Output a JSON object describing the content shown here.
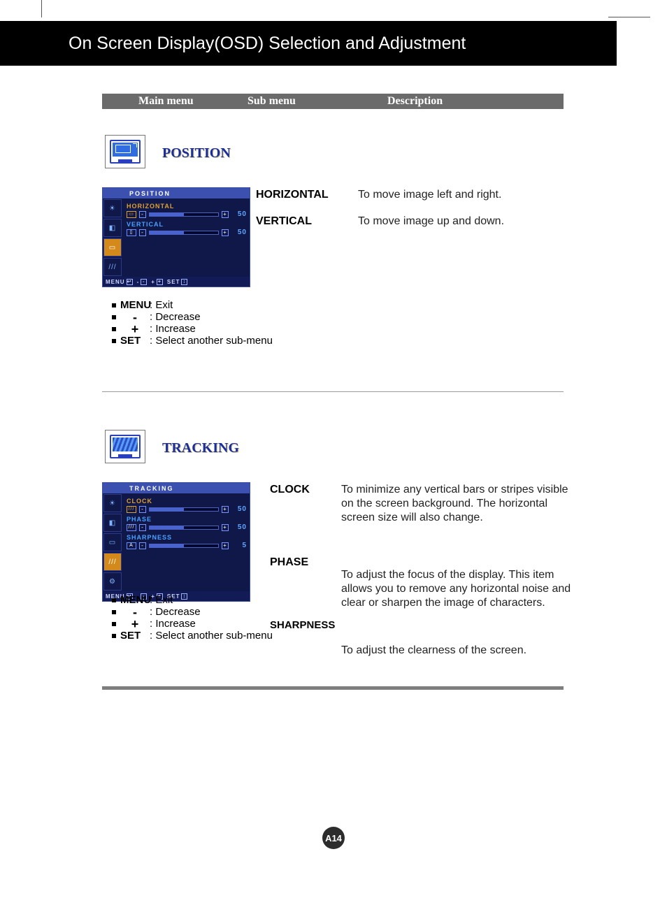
{
  "page_title": "On Screen Display(OSD) Selection and Adjustment",
  "headers": {
    "main": "Main menu",
    "sub": "Sub menu",
    "desc": "Description"
  },
  "position": {
    "title": "POSITION",
    "osd_title": "POSITION",
    "sliders": {
      "horizontal": {
        "label": "HORIZONTAL",
        "value": "50"
      },
      "vertical": {
        "label": "VERTICAL",
        "value": "50"
      }
    },
    "footer": {
      "menu": "MENU",
      "minus": "-",
      "plus": "+",
      "set": "SET"
    },
    "sub": {
      "horizontal": "HORIZONTAL",
      "vertical": "VERTICAL"
    },
    "desc": {
      "horizontal": "To move image left and right.",
      "vertical": "To move image up and down."
    }
  },
  "tracking": {
    "title": "TRACKING",
    "osd_title": "TRACKING",
    "sliders": {
      "clock": {
        "label": "CLOCK",
        "value": "50"
      },
      "phase": {
        "label": "PHASE",
        "value": "50"
      },
      "sharpness": {
        "label": "SHARPNESS",
        "value": "5"
      }
    },
    "footer": {
      "menu": "MENU",
      "minus": "-",
      "plus": "+",
      "set": "SET"
    },
    "sub": {
      "clock": "CLOCK",
      "phase": "PHASE",
      "sharpness": "SHARPNESS"
    },
    "desc": {
      "clock": "To minimize any vertical bars or stripes visible on the screen background. The horizontal screen size will also change.",
      "phase": "To adjust the focus of the display. This item allows you to remove any horizontal noise and clear or sharpen the image of characters.",
      "sharpness": "To adjust the clearness of the screen."
    }
  },
  "legend": {
    "menu": {
      "key": "MENU",
      "text": ": Exit"
    },
    "minus": {
      "key": "-",
      "text": ": Decrease"
    },
    "plus": {
      "key": "+",
      "text": ": Increase"
    },
    "set": {
      "key": "SET",
      "text": ": Select another sub-menu"
    }
  },
  "page_number": "A14"
}
